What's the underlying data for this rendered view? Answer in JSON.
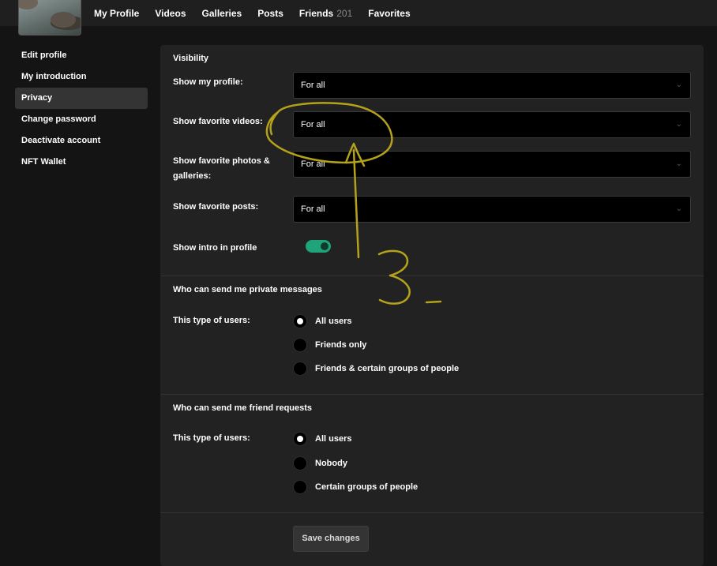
{
  "header": {
    "nav": [
      {
        "label": "My Profile"
      },
      {
        "label": "Videos"
      },
      {
        "label": "Galleries"
      },
      {
        "label": "Posts"
      },
      {
        "label": "Friends",
        "count": "201"
      },
      {
        "label": "Favorites"
      }
    ]
  },
  "sidebar": {
    "items": [
      {
        "label": "Edit profile"
      },
      {
        "label": "My introduction"
      },
      {
        "label": "Privacy",
        "active": true
      },
      {
        "label": "Change password"
      },
      {
        "label": "Deactivate account"
      },
      {
        "label": "NFT Wallet"
      }
    ]
  },
  "visibility": {
    "title": "Visibility",
    "rows": [
      {
        "label": "Show my profile:",
        "value": "For all"
      },
      {
        "label": "Show favorite videos:",
        "value": "For all"
      },
      {
        "label": "Show favorite photos & galleries:",
        "value": "For all"
      },
      {
        "label": "Show favorite posts:",
        "value": "For all"
      }
    ],
    "intro_toggle": {
      "label": "Show intro in profile",
      "on": true
    }
  },
  "messages": {
    "title": "Who can send me private messages",
    "label": "This type of users:",
    "options": [
      "All users",
      "Friends only",
      "Friends & certain groups of people"
    ],
    "selected": "All users"
  },
  "friend_requests": {
    "title": "Who can send me friend requests",
    "label": "This type of users:",
    "options": [
      "All users",
      "Nobody",
      "Certain groups of people"
    ],
    "selected": "All users"
  },
  "actions": {
    "save_label": "Save changes"
  },
  "colors": {
    "toggle_on": "#1fa37a",
    "annotation": "#b5a21b",
    "panel": "#222222",
    "page": "#141414"
  }
}
